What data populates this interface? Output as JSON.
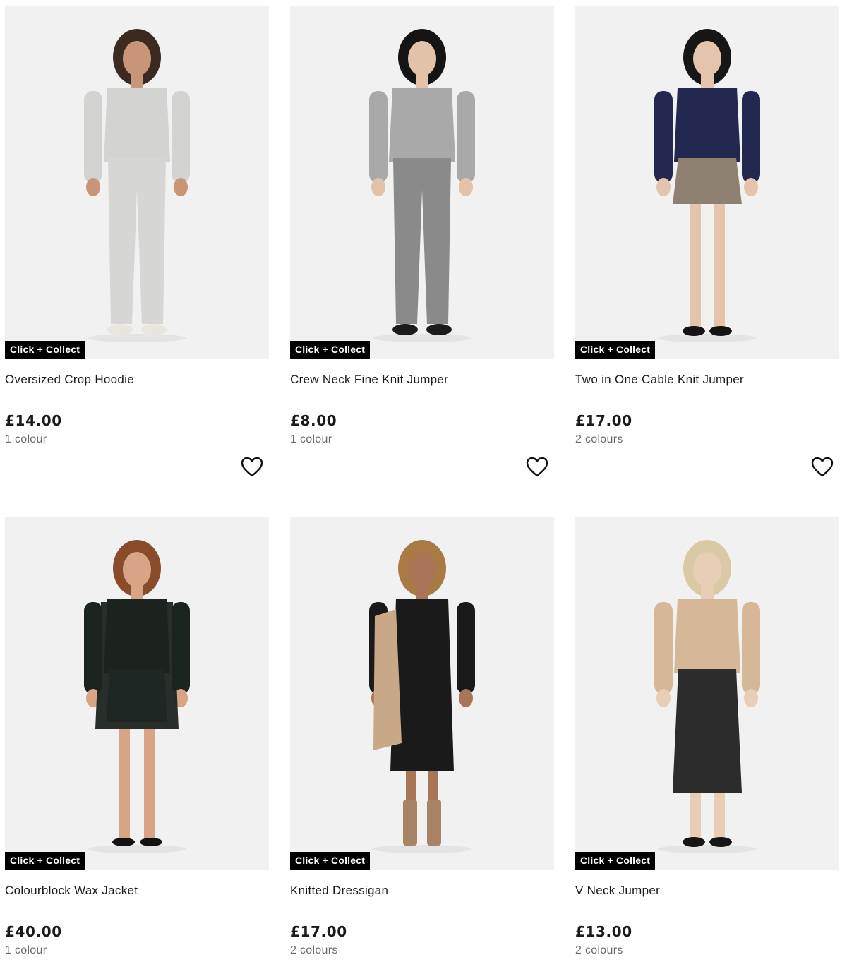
{
  "products": [
    {
      "name": "Oversized Crop Hoodie",
      "price": "£14.00",
      "colours": "1 colour",
      "badge": "Click + Collect",
      "wishlist_icon": "heart-outline-icon",
      "palette": {
        "hair": "#3a2a1f",
        "skin": "#c89676",
        "top": "#d3d3d1",
        "bottom": "#d6d6d4",
        "shoes": "#e9e6df"
      }
    },
    {
      "name": "Crew Neck Fine Knit Jumper",
      "price": "£8.00",
      "colours": "1 colour",
      "badge": "Click + Collect",
      "wishlist_icon": "heart-outline-icon",
      "palette": {
        "hair": "#141414",
        "skin": "#e2c2a8",
        "top": "#a9a9aa",
        "bottom": "#8a8a8b",
        "shoes": "#1b1b1b"
      }
    },
    {
      "name": "Two in One Cable Knit Jumper",
      "price": "£17.00",
      "colours": "2 colours",
      "badge": "Click + Collect",
      "wishlist_icon": "heart-outline-icon",
      "palette": {
        "hair": "#161616",
        "skin": "#e4c4ac",
        "top": "#232850",
        "bottom": "#8e8172",
        "shoes": "#141414"
      }
    },
    {
      "name": "Colourblock Wax Jacket",
      "price": "£40.00",
      "colours": "1 colour",
      "badge": "Click + Collect",
      "wishlist_icon": "heart-outline-icon",
      "palette": {
        "hair": "#8a4b2a",
        "skin": "#d7a585",
        "top": "#1c2420",
        "bottom": "#4a6c91",
        "shoes": "#121212"
      }
    },
    {
      "name": "Knitted Dressigan",
      "price": "£17.00",
      "colours": "2 colours",
      "badge": "Click + Collect",
      "wishlist_icon": "heart-outline-icon",
      "palette": {
        "hair": "#a87a44",
        "skin": "#a87557",
        "top": "#1a1a1a",
        "bottom": "#1a1a1a",
        "shoes": "#a88466"
      }
    },
    {
      "name": "V Neck Jumper",
      "price": "£13.00",
      "colours": "2 colours",
      "badge": "Click + Collect",
      "wishlist_icon": "heart-outline-icon",
      "palette": {
        "hair": "#d9c9a5",
        "skin": "#e8cdb7",
        "top": "#d6b797",
        "bottom": "#2c2c2c",
        "shoes": "#161616"
      }
    }
  ]
}
